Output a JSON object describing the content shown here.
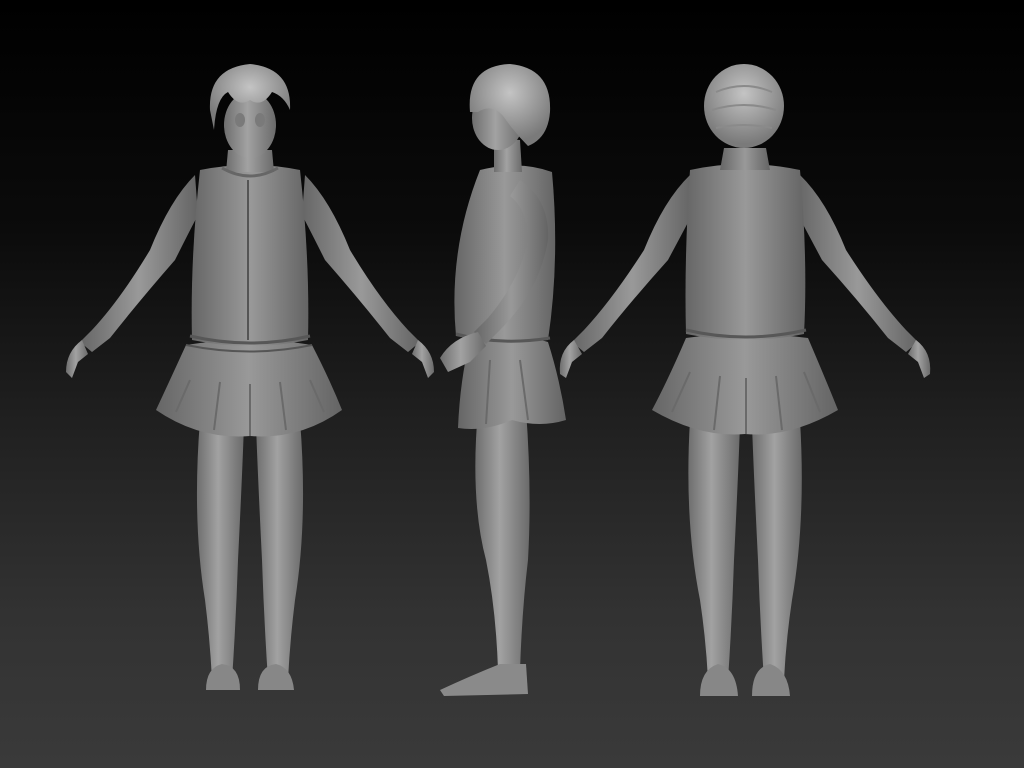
{
  "scene": {
    "background_colors": [
      "#000000",
      "#202020",
      "#3a3a3a"
    ],
    "model_color": "#8e8e8e",
    "views": [
      {
        "view": "front"
      },
      {
        "view": "side"
      },
      {
        "view": "back"
      }
    ]
  }
}
